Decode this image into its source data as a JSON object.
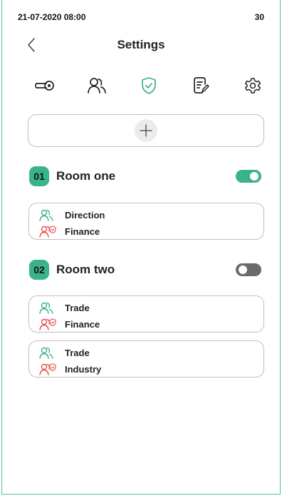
{
  "status": {
    "datetime": "21-07-2020 08:00",
    "battery": "30"
  },
  "header": {
    "title": "Settings"
  },
  "tabs": [
    {
      "icon": "key-icon",
      "active": false
    },
    {
      "icon": "users-icon",
      "active": false
    },
    {
      "icon": "shield-check-icon",
      "active": true
    },
    {
      "icon": "note-edit-icon",
      "active": false
    },
    {
      "icon": "gear-icon",
      "active": false
    }
  ],
  "rooms": [
    {
      "number": "01",
      "name": "Room one",
      "enabled": true,
      "cards": [
        {
          "group": "Direction",
          "permission": "Finance"
        }
      ]
    },
    {
      "number": "02",
      "name": "Room two",
      "enabled": false,
      "cards": [
        {
          "group": "Trade",
          "permission": "Finance"
        },
        {
          "group": "Trade",
          "permission": "Industry"
        }
      ]
    }
  ],
  "colors": {
    "accent": "#3ab388",
    "alert": "#e8504a",
    "border": "#bfbfbf"
  }
}
